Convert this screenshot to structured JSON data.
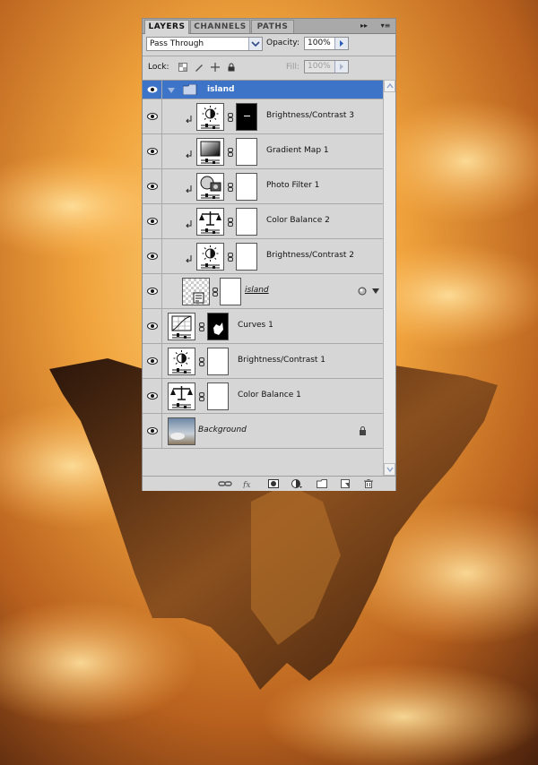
{
  "panel": {
    "tabs": [
      {
        "label": "LAYERS",
        "active": true
      },
      {
        "label": "CHANNELS",
        "active": false
      },
      {
        "label": "PATHS",
        "active": false
      }
    ],
    "blend_mode": "Pass Through",
    "opacity_label": "Opacity:",
    "opacity_value": "100%",
    "lock_label": "Lock:",
    "fill_label": "Fill:",
    "fill_value": "100%"
  },
  "layers": [
    {
      "name": "island",
      "kind": "group",
      "selected": true
    },
    {
      "name": "Brightness/Contrast 3",
      "kind": "brightness",
      "clipped": true,
      "indent": true,
      "mask": "black-bar"
    },
    {
      "name": "Gradient Map 1",
      "kind": "gradient",
      "clipped": true,
      "indent": true,
      "mask": "white"
    },
    {
      "name": "Photo Filter 1",
      "kind": "photo",
      "clipped": true,
      "indent": true,
      "mask": "white"
    },
    {
      "name": "Color Balance 2",
      "kind": "balance",
      "clipped": true,
      "indent": true,
      "mask": "white"
    },
    {
      "name": "Brightness/Contrast 2",
      "kind": "brightness",
      "clipped": true,
      "indent": true,
      "mask": "white"
    },
    {
      "name": "island",
      "kind": "smart",
      "indent": true,
      "mask": "white"
    },
    {
      "name": "Curves 1",
      "kind": "curves",
      "mask": "black-shape"
    },
    {
      "name": "Brightness/Contrast 1",
      "kind": "brightness",
      "mask": "white"
    },
    {
      "name": "Color Balance 1",
      "kind": "balance",
      "mask": "white"
    },
    {
      "name": "Background",
      "kind": "image",
      "locked": true
    }
  ],
  "colors": {
    "panel_bg": "#d6d6d6",
    "selection": "#3d74c8",
    "sky_top": "#5a2e14",
    "sky_glow": "#ffd27a"
  }
}
